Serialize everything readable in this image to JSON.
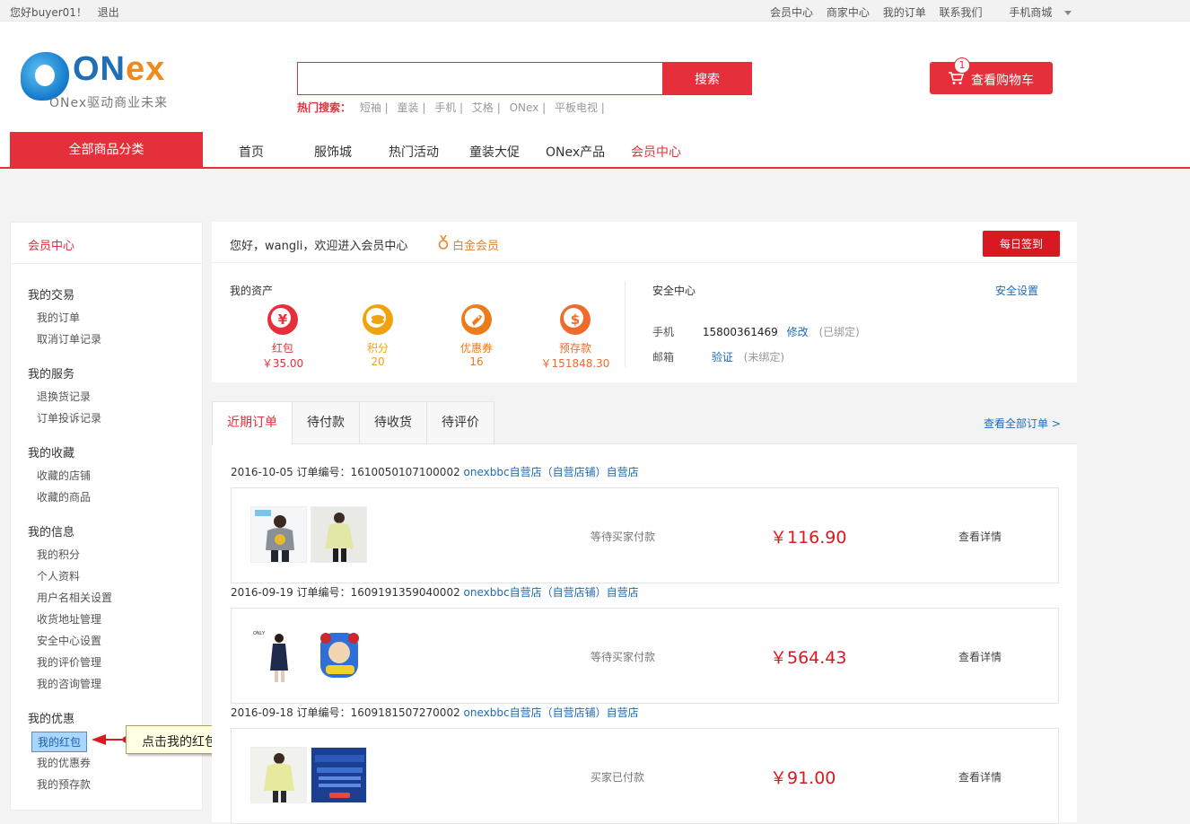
{
  "top_bar": {
    "greeting": "您好buyer01！",
    "logout": "退出",
    "links": [
      "会员中心",
      "商家中心",
      "我的订单",
      "联系我们"
    ],
    "mobile": "手机商城"
  },
  "logo": {
    "word_on": "ON",
    "word_ex": "ex",
    "slogan": "ONex驱动商业未来"
  },
  "search": {
    "placeholder": "",
    "button": "搜索",
    "hot_label": "热门搜索：",
    "hot_keywords": [
      "短袖 |",
      "童装 |",
      "手机 |",
      "艾格 |",
      "ONex |",
      "平板电视 |"
    ]
  },
  "cart": {
    "label": "查看购物车",
    "count": "1"
  },
  "nav": {
    "all_categories": "全部商品分类",
    "items": [
      "首页",
      "服饰城",
      "热门活动",
      "童装大促",
      "ONex产品",
      "会员中心"
    ]
  },
  "sidebar": {
    "title": "会员中心",
    "groups": [
      {
        "label": "我的交易",
        "items": [
          "我的订单",
          "取消订单记录"
        ]
      },
      {
        "label": "我的服务",
        "items": [
          "退换货记录",
          "订单投诉记录"
        ]
      },
      {
        "label": "我的收藏",
        "items": [
          "收藏的店铺",
          "收藏的商品"
        ]
      },
      {
        "label": "我的信息",
        "items": [
          "我的积分",
          "个人资料",
          "用户名相关设置",
          "收货地址管理",
          "安全中心设置",
          "我的评价管理",
          "我的咨询管理"
        ]
      },
      {
        "label": "我的优惠",
        "items": [
          "我的红包",
          "我的优惠券",
          "我的预存款"
        ]
      }
    ]
  },
  "callout": {
    "text": "点击我的红包"
  },
  "welcome": {
    "greeting": "您好，wangli，欢迎进入会员中心",
    "level": "白金会员",
    "checkin": "每日签到"
  },
  "assets": {
    "title": "我的资产",
    "items": [
      {
        "icon": "red-packet-icon",
        "symbol": "¥",
        "name": "红包",
        "value": "￥35.00",
        "color": "#e5303b"
      },
      {
        "icon": "points-icon",
        "symbol": "",
        "name": "积分",
        "value": "20",
        "color": "#f2a20c"
      },
      {
        "icon": "coupon-icon",
        "symbol": "",
        "name": "优惠券",
        "value": "16",
        "color": "#ec7b1a"
      },
      {
        "icon": "deposit-icon",
        "symbol": "$",
        "name": "预存款",
        "value": "￥151848.30",
        "color": "#ef6a2b"
      }
    ]
  },
  "security": {
    "title": "安全中心",
    "settings": "安全设置",
    "phone_label": "手机",
    "phone": "15800361469",
    "phone_action": "修改",
    "phone_status": "(已绑定)",
    "email_label": "邮箱",
    "email_action": "验证",
    "email_status": "(未绑定)"
  },
  "orders": {
    "tabs": [
      "近期订单",
      "待付款",
      "待收货",
      "待评价"
    ],
    "view_all": "查看全部订单 >",
    "list": [
      {
        "head": "2016-10-05 订单编号：1610050107100002",
        "store": "onexbbc自营店（自营店铺）自营店",
        "status": "等待买家付款",
        "price": "￥116.90",
        "detail": "查看详情"
      },
      {
        "head": "2016-09-19 订单编号：1609191359040002",
        "store": "onexbbc自营店（自营店铺）自营店",
        "status": "等待买家付款",
        "price": "￥564.43",
        "detail": "查看详情"
      },
      {
        "head": "2016-09-18 订单编号：1609181507270002",
        "store": "onexbbc自营店（自营店铺）自营店",
        "status": "买家已付款",
        "price": "￥91.00",
        "detail": "查看详情"
      }
    ]
  },
  "colors": {
    "accent": "#e5303b",
    "link": "#1f6ab5",
    "level": "#e9822c"
  }
}
